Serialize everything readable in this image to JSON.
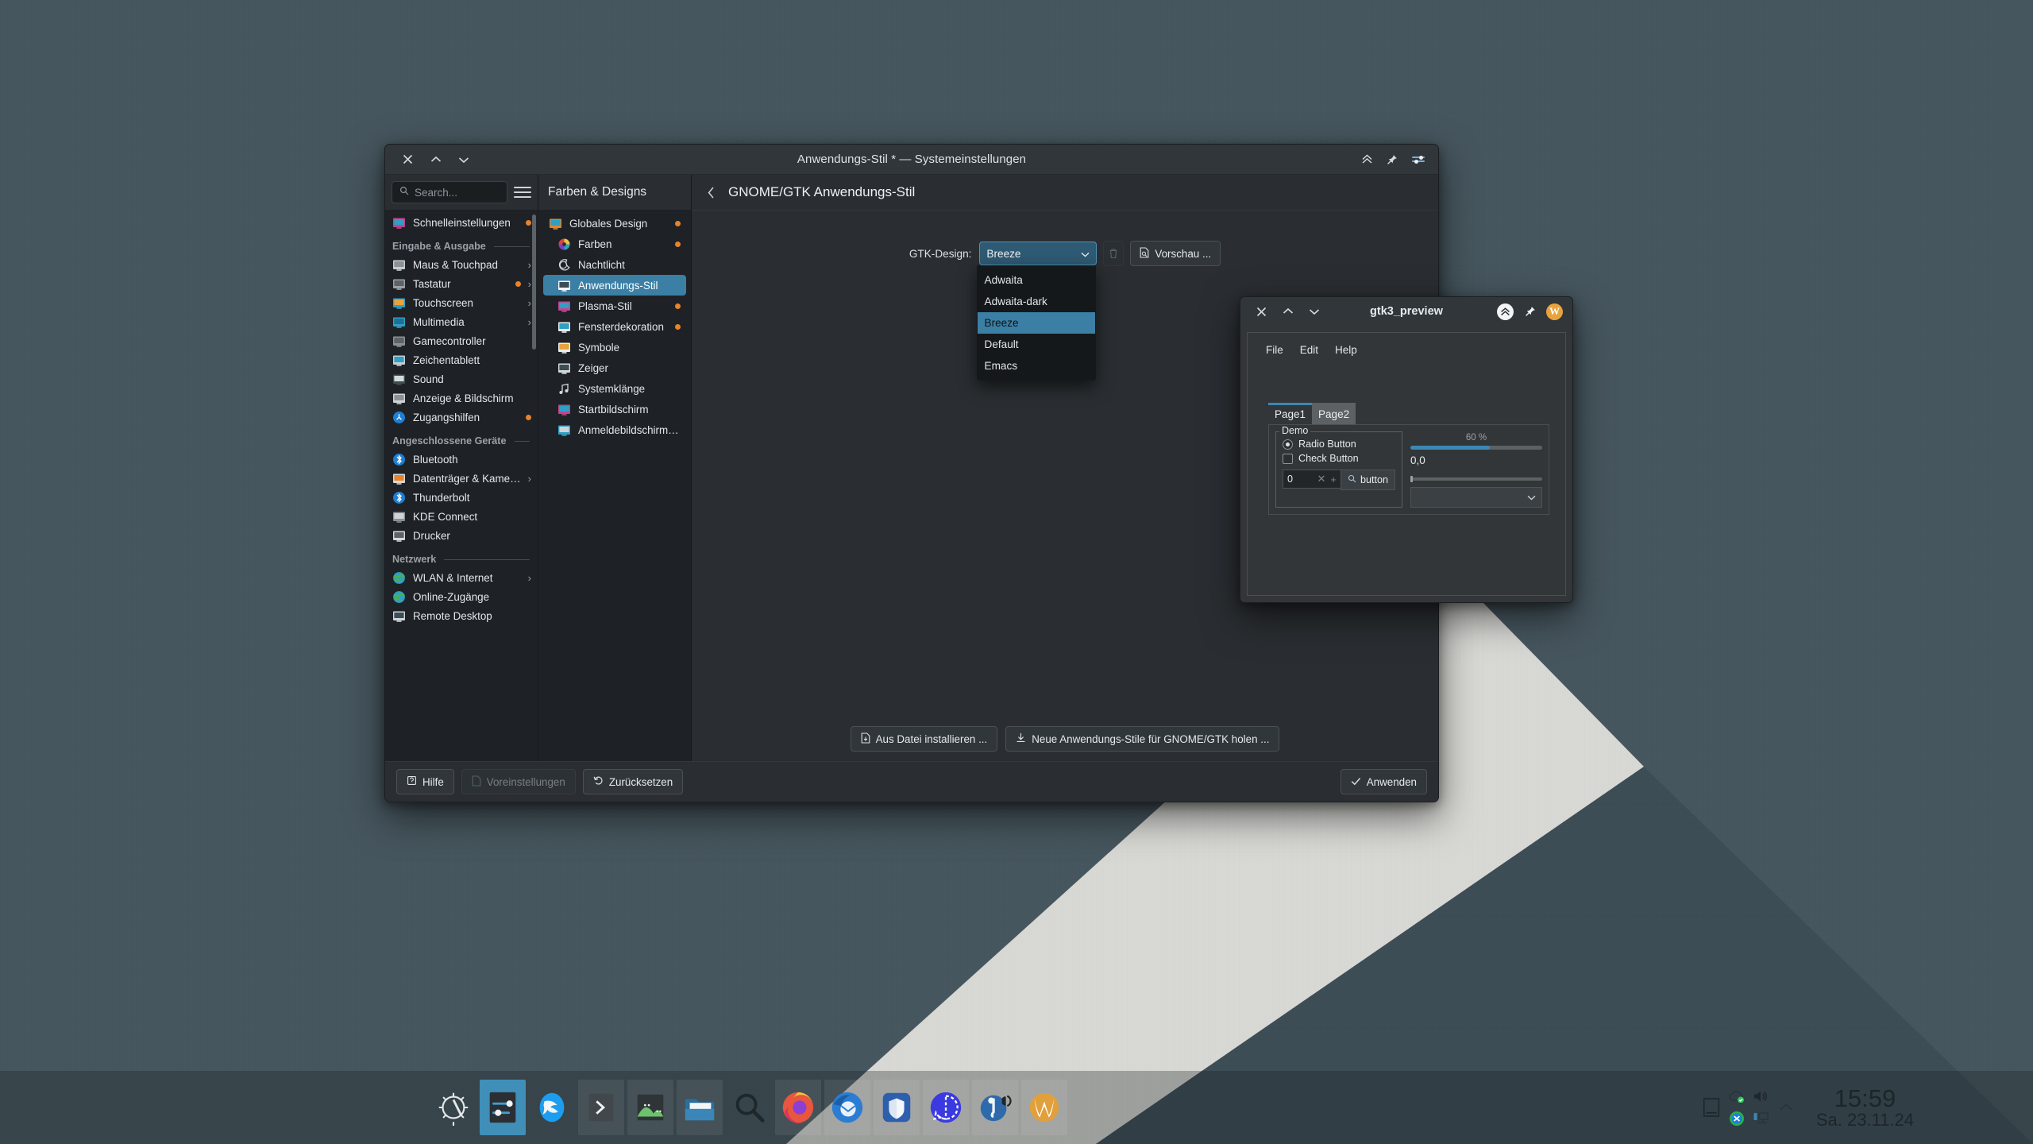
{
  "window": {
    "title": "Anwendungs-Stil * — Systemeinstellungen",
    "controls": {
      "close": "close-icon",
      "minimize": "minimize-icon",
      "maximize": "maximize-icon",
      "keep_above": "keep-above-icon",
      "pin": "pin-icon",
      "app_icon": "systemsettings-icon"
    }
  },
  "search": {
    "placeholder": "Search...",
    "value": ""
  },
  "menu_button": "hamburger-menu",
  "sidebar": {
    "top_items": [
      {
        "label": "Schnelleinstellungen",
        "dot": true,
        "chevron": false,
        "icon": "quick-settings-icon"
      }
    ],
    "groups": [
      {
        "header": "Eingabe & Ausgabe",
        "items": [
          {
            "label": "Maus & Touchpad",
            "dot": false,
            "chevron": true,
            "icon": "mouse-icon"
          },
          {
            "label": "Tastatur",
            "dot": true,
            "chevron": true,
            "icon": "keyboard-icon"
          },
          {
            "label": "Touchscreen",
            "dot": false,
            "chevron": true,
            "icon": "touchscreen-icon"
          },
          {
            "label": "Multimedia",
            "dot": false,
            "chevron": true,
            "icon": "multimedia-icon"
          },
          {
            "label": "Gamecontroller",
            "dot": false,
            "chevron": false,
            "icon": "gamepad-icon"
          },
          {
            "label": "Zeichentablett",
            "dot": false,
            "chevron": false,
            "icon": "tablet-icon"
          },
          {
            "label": "Sound",
            "dot": false,
            "chevron": false,
            "icon": "sound-icon"
          },
          {
            "label": "Anzeige & Bildschirm",
            "dot": false,
            "chevron": false,
            "icon": "display-icon"
          },
          {
            "label": "Zugangshilfen",
            "dot": true,
            "chevron": false,
            "icon": "accessibility-icon"
          }
        ]
      },
      {
        "header": "Angeschlossene Geräte",
        "items": [
          {
            "label": "Bluetooth",
            "dot": false,
            "chevron": false,
            "icon": "bluetooth-icon"
          },
          {
            "label": "Datenträger & Kameras",
            "dot": false,
            "chevron": true,
            "icon": "drive-icon"
          },
          {
            "label": "Thunderbolt",
            "dot": false,
            "chevron": false,
            "icon": "thunderbolt-icon"
          },
          {
            "label": "KDE Connect",
            "dot": false,
            "chevron": false,
            "icon": "kdeconnect-icon"
          },
          {
            "label": "Drucker",
            "dot": false,
            "chevron": false,
            "icon": "printer-icon"
          }
        ]
      },
      {
        "header": "Netzwerk",
        "items": [
          {
            "label": "WLAN & Internet",
            "dot": false,
            "chevron": true,
            "icon": "globe-icon"
          },
          {
            "label": "Online-Zugänge",
            "dot": false,
            "chevron": false,
            "icon": "online-accounts-icon"
          },
          {
            "label": "Remote Desktop",
            "dot": false,
            "chevron": false,
            "icon": "remote-desktop-icon"
          }
        ]
      }
    ]
  },
  "modules": {
    "header": "Farben & Designs",
    "items": [
      {
        "label": "Globales Design",
        "indent": false,
        "dot": true,
        "selected": false,
        "icon": "global-theme-icon"
      },
      {
        "label": "Farben",
        "indent": true,
        "dot": true,
        "selected": false,
        "icon": "colors-icon"
      },
      {
        "label": "Nachtlicht",
        "indent": true,
        "dot": false,
        "selected": false,
        "icon": "nightlight-icon"
      },
      {
        "label": "Anwendungs-Stil",
        "indent": true,
        "dot": false,
        "selected": true,
        "icon": "application-style-icon"
      },
      {
        "label": "Plasma-Stil",
        "indent": true,
        "dot": true,
        "selected": false,
        "icon": "plasma-style-icon"
      },
      {
        "label": "Fensterdekoration",
        "indent": true,
        "dot": true,
        "selected": false,
        "icon": "window-decoration-icon"
      },
      {
        "label": "Symbole",
        "indent": true,
        "dot": false,
        "selected": false,
        "icon": "icons-icon"
      },
      {
        "label": "Zeiger",
        "indent": true,
        "dot": false,
        "selected": false,
        "icon": "cursor-icon"
      },
      {
        "label": "Systemklänge",
        "indent": true,
        "dot": false,
        "selected": false,
        "icon": "sounds-icon"
      },
      {
        "label": "Startbildschirm",
        "indent": true,
        "dot": false,
        "selected": false,
        "icon": "splash-screen-icon"
      },
      {
        "label": "Anmeldebildschirm (...",
        "indent": true,
        "dot": false,
        "selected": false,
        "icon": "login-screen-icon"
      }
    ]
  },
  "content": {
    "back": "back-icon",
    "title": "GNOME/GTK Anwendungs-Stil",
    "gtk_label": "GTK-Design:",
    "gtk_value": "Breeze",
    "gtk_options": [
      "Adwaita",
      "Adwaita-dark",
      "Breeze",
      "Default",
      "Emacs"
    ],
    "gtk_selected_option": "Breeze",
    "delete_button": "trash-icon",
    "preview_button": "Vorschau ...",
    "install_from_file": "Aus Datei installieren ...",
    "get_new_styles": "Neue Anwendungs-Stile für GNOME/GTK holen ..."
  },
  "footer": {
    "help": "Hilfe",
    "defaults": "Voreinstellungen",
    "reset": "Zurücksetzen",
    "apply": "Anwenden"
  },
  "preview_window": {
    "title": "gtk3_preview",
    "menu": [
      "File",
      "Edit",
      "Help"
    ],
    "tabs": [
      {
        "label": "Page1",
        "active": true
      },
      {
        "label": "Page2",
        "active": false
      }
    ],
    "frame_legend": "Demo",
    "radio_label": "Radio Button",
    "check_label": "Check Button",
    "spin_value": "0",
    "button_label": "button",
    "progress_label": "60 %",
    "progress_percent": 60,
    "scale_value": "0,0",
    "combo_value": ""
  },
  "panel": {
    "tasks": [
      {
        "name": "kde-plasma-logo",
        "state": "idle"
      },
      {
        "name": "systemsettings",
        "state": "active"
      },
      {
        "name": "falkon-browser",
        "state": "idle"
      },
      {
        "name": "konsole-terminal",
        "state": "running"
      },
      {
        "name": "gwenview-images",
        "state": "running"
      },
      {
        "name": "dolphin-filemanager",
        "state": "running"
      },
      {
        "name": "krunner-search",
        "state": "idle"
      },
      {
        "name": "firefox",
        "state": "running"
      },
      {
        "name": "thunderbird",
        "state": "running"
      },
      {
        "name": "bitwarden",
        "state": "running"
      },
      {
        "name": "signal",
        "state": "running"
      },
      {
        "name": "audio-player",
        "state": "running"
      },
      {
        "name": "wesnoth",
        "state": "running"
      }
    ],
    "tray": [
      "cloud-sync-icon",
      "volume-icon",
      "overflow-arrow-icon",
      "clipboard-icon",
      "sync-icon",
      "network-icon"
    ],
    "clock_time": "15:59",
    "clock_date": "Sa. 23.11.24"
  },
  "colors": {
    "accent": "#3b7fa5",
    "attention_dot": "#e8832a",
    "window_bg": "#2a2e32",
    "sidebar_bg": "#1e2226",
    "titlebar_bg": "#31363b",
    "wallpaper_light": "#4a5a62",
    "wallpaper_dark": "#212f36",
    "wallpaper_band": "#d8d8d4"
  }
}
